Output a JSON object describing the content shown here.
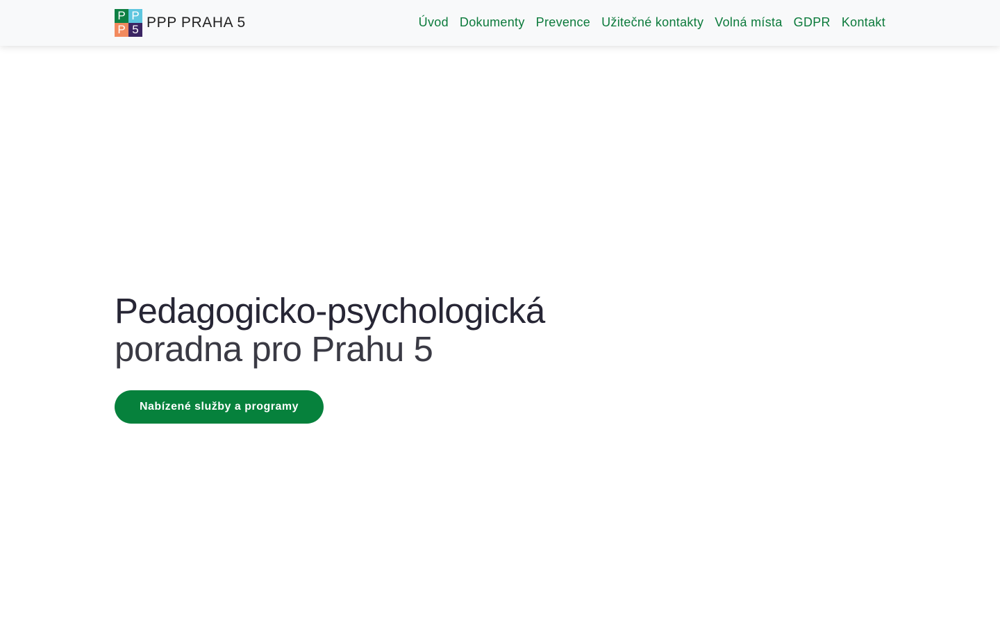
{
  "header": {
    "brand": {
      "logo": {
        "cells": [
          {
            "letter": "P",
            "color": "#0e8043"
          },
          {
            "letter": "P",
            "color": "#5ec6df"
          },
          {
            "letter": "P",
            "color": "#f28a5e"
          },
          {
            "letter": "5",
            "color": "#3b2563"
          }
        ]
      },
      "title": "PPP PRAHA 5"
    },
    "nav": [
      {
        "label": "Úvod"
      },
      {
        "label": "Dokumenty"
      },
      {
        "label": "Prevence"
      },
      {
        "label": "Užitečné kontakty"
      },
      {
        "label": "Volná místa"
      },
      {
        "label": "GDPR"
      },
      {
        "label": "Kontakt"
      }
    ]
  },
  "hero": {
    "title": "Pedagogicko-psychologická",
    "subtitle": "poradna pro Prahu 5",
    "button_label": "Nabízené služby a programy"
  },
  "colors": {
    "accent": "#06813c",
    "nav_link": "#0b7a3b",
    "navbar_bg": "#f8f9fa",
    "heading": "#272635"
  }
}
